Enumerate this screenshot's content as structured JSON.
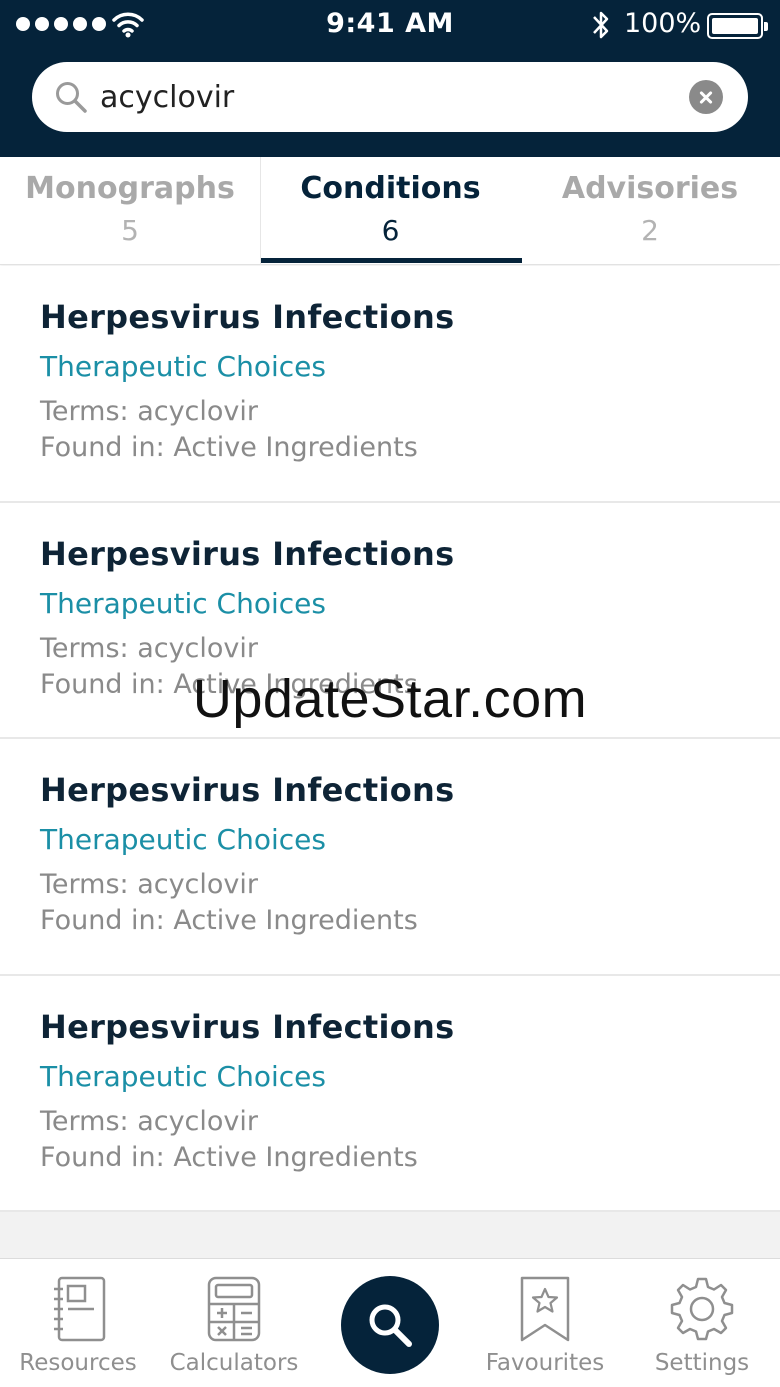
{
  "status_bar": {
    "time": "9:41 AM",
    "battery": "100%",
    "signal_icon": "signal-dots-icon",
    "wifi_icon": "wifi-icon",
    "bluetooth_icon": "bluetooth-icon"
  },
  "search": {
    "value": "acyclovir",
    "placeholder": "Search",
    "search_icon": "search-icon",
    "clear_icon": "clear-icon"
  },
  "tabs": [
    {
      "label": "Monographs",
      "count": "5",
      "active": false
    },
    {
      "label": "Conditions",
      "count": "6",
      "active": true
    },
    {
      "label": "Advisories",
      "count": "2",
      "active": false
    }
  ],
  "results": [
    {
      "title": "Herpesvirus Infections",
      "link": "Therapeutic Choices",
      "terms": "Terms: acyclovir",
      "found_in": "Found in: Active Ingredients"
    },
    {
      "title": "Herpesvirus Infections",
      "link": "Therapeutic Choices",
      "terms": "Terms: acyclovir",
      "found_in": "Found in: Active Ingredients"
    },
    {
      "title": "Herpesvirus Infections",
      "link": "Therapeutic Choices",
      "terms": "Terms: acyclovir",
      "found_in": "Found in: Active Ingredients"
    },
    {
      "title": "Herpesvirus Infections",
      "link": "Therapeutic Choices",
      "terms": "Terms: acyclovir",
      "found_in": "Found in: Active Ingredients"
    }
  ],
  "watermark": "UpdateStar.com",
  "tabbar": {
    "resources": "Resources",
    "calculators": "Calculators",
    "favourites": "Favourites",
    "settings": "Settings"
  },
  "colors": {
    "header_bg": "#05233a",
    "link": "#1b8fa6",
    "title": "#0e2436",
    "muted": "#8a8a8a"
  }
}
